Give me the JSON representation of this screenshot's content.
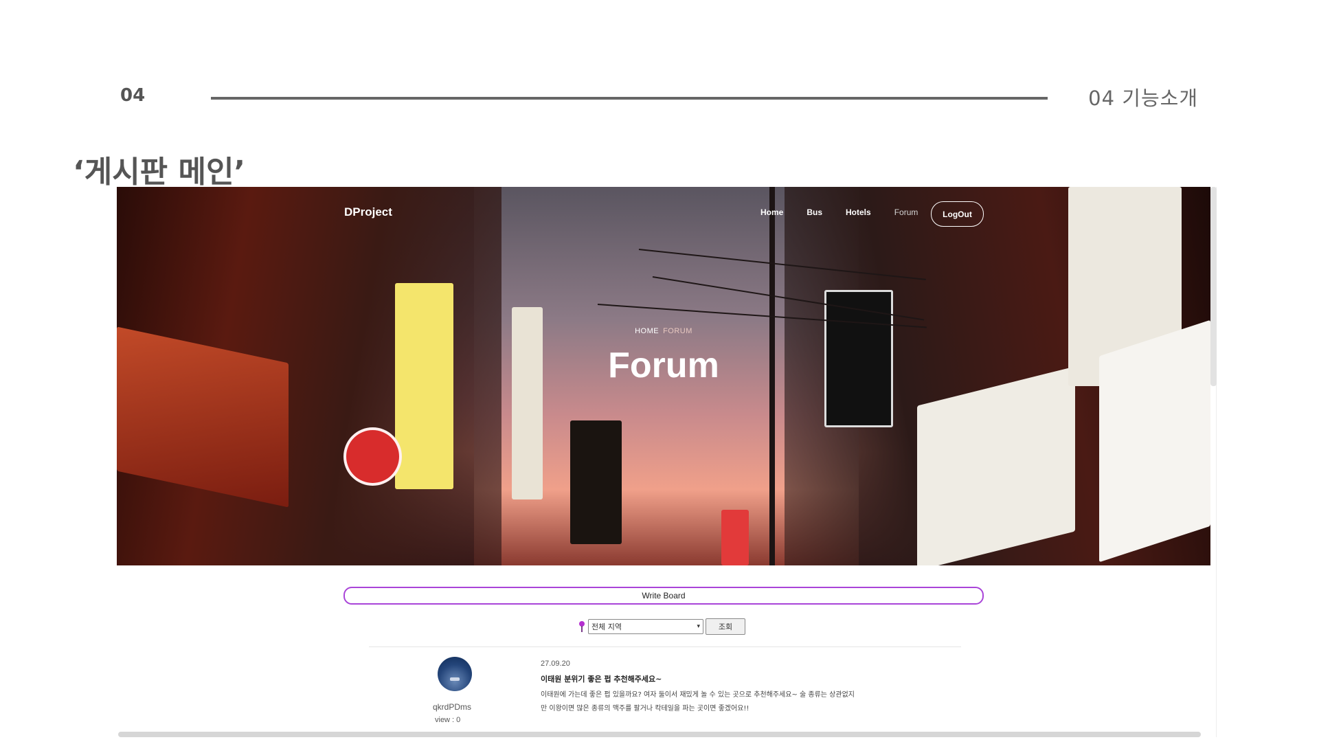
{
  "slide": {
    "number": "04",
    "section": "04  기능소개",
    "title": "‘게시판 메인’"
  },
  "site": {
    "logo": "DProject",
    "nav": [
      {
        "label": "Home"
      },
      {
        "label": "Bus"
      },
      {
        "label": "Hotels"
      },
      {
        "label": "Forum"
      }
    ],
    "logout_label": "LogOut",
    "breadcrumb": {
      "home": "HOME",
      "current": "FORUM"
    },
    "hero_title": "Forum"
  },
  "board": {
    "write_label": "Write Board",
    "region_selected": "전체 지역",
    "query_label": "조회",
    "posts": [
      {
        "date": "27.09.20",
        "title": "이태원 분위기 좋은 펍 추천해주세요~",
        "body_line1": "이태원에 가는데 좋은 펍 있을까요? 여자 둘이서 재밌게 놀 수 있는 곳으로 추천해주세요~ 술 종류는 상관없지",
        "body_line2": "만 이왕이면 많은 종류의 맥주를 팔거나 칵테일을 파는 곳이면 좋겠어요!!",
        "author": "qkrdPDms",
        "views": "view : 0"
      }
    ]
  },
  "colors": {
    "accent": "#a944d8",
    "rule": "#666666"
  }
}
